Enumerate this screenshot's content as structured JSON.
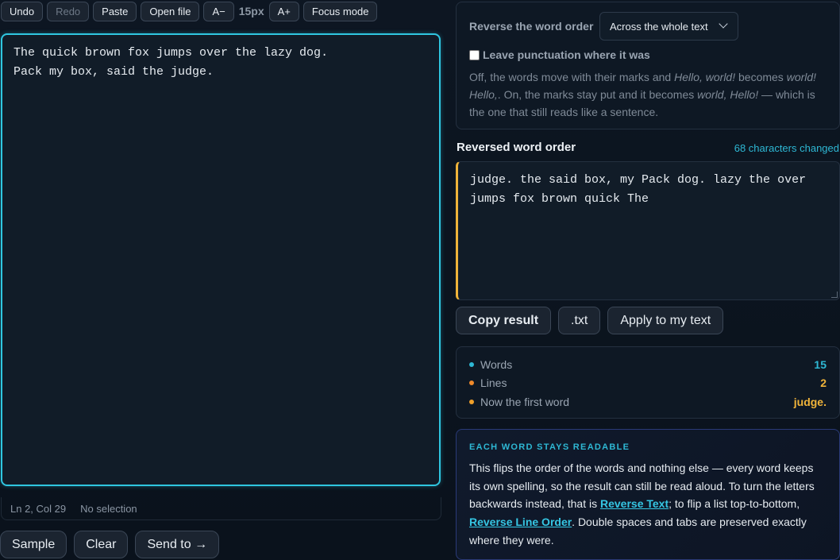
{
  "toolbar": {
    "undo": "Undo",
    "redo": "Redo",
    "paste": "Paste",
    "open_file": "Open file",
    "decrease_font": "A−",
    "font_size": "15px",
    "increase_font": "A+",
    "focus_mode": "Focus mode"
  },
  "editor": {
    "lines": [
      "The quick brown fox jumps over the lazy dog.",
      "Pack my box, said the judge."
    ],
    "status_position": "Ln 2, Col 29",
    "status_selection": "No selection"
  },
  "actions": {
    "sample": "Sample",
    "clear": "Clear",
    "send_to": "Send to →"
  },
  "options": {
    "order_label": "Reverse the word order",
    "order_value": "Across the whole text",
    "punctuation_label": "Leave punctuation where it was",
    "punctuation_checked": false,
    "help": {
      "p1": "Off, the words move with their marks and ",
      "ex1": "Hello, world!",
      "p2": " becomes ",
      "ex2": "world! Hello,",
      "p3": ". On, the marks stay put and it becomes ",
      "ex3": "world, Hello!",
      "p4": " — which is the one that still reads like a sentence."
    }
  },
  "result": {
    "title": "Reversed word order",
    "changed": "68 characters changed",
    "text": "judge. the said box, my Pack dog. lazy the over jumps fox brown quick The",
    "copy": "Copy result",
    "txt": ".txt",
    "apply": "Apply to my text"
  },
  "stats": [
    {
      "label": "Words",
      "value": "15",
      "dot_color": "#2eb8d4",
      "value_color": "#2eb8d4"
    },
    {
      "label": "Lines",
      "value": "2",
      "dot_color": "#f08a2a",
      "value_color": "#f0b43a"
    },
    {
      "label": "Now the first word",
      "value": "judge.",
      "dot_color": "#f0a02a",
      "value_color": "#f0b43a"
    }
  ],
  "info": {
    "heading": "EACH WORD STAYS READABLE",
    "t1": "This flips the order of the words and nothing else — every word keeps its own spelling, so the result can still be read aloud. To turn the letters backwards instead, that is ",
    "link1": "Reverse Text",
    "t2": "; to flip a list top-to-bottom, ",
    "link2": "Reverse Line Order",
    "t3": ". Double spaces and tabs are preserved exactly where they were."
  },
  "colors": {
    "accent": "#2fc6e0",
    "result_accent": "#f0b43a"
  }
}
